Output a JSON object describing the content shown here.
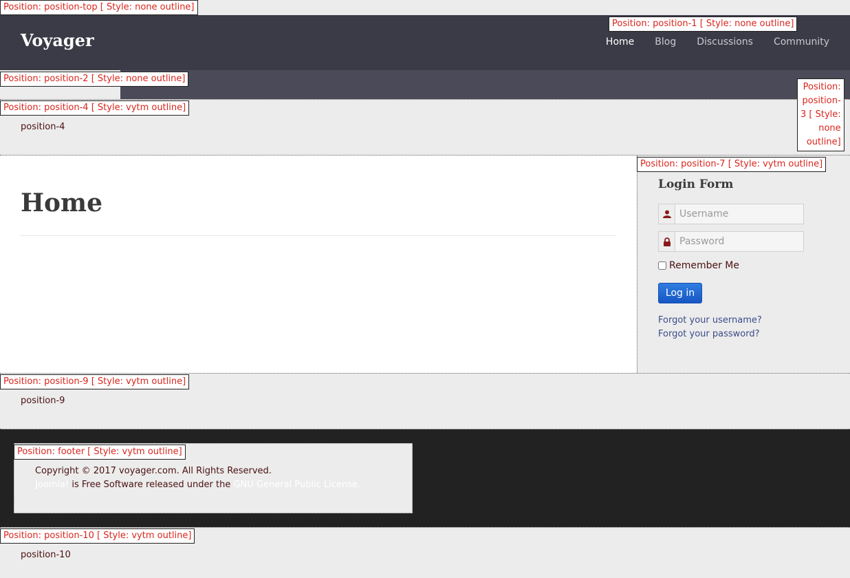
{
  "labels": {
    "position_top": "Position: position-top [ Style: none outline]",
    "position_1": "Position: position-1 [ Style: none outline]",
    "position_2": "Position: position-2 [ Style: none outline]",
    "position_3": [
      "Position:",
      "position-",
      "3 [ Style:",
      "none",
      "outline]"
    ],
    "position_4": "Position: position-4 [ Style: vytm outline]",
    "position_7": "Position: position-7 [ Style: vytm outline]",
    "position_9": "Position: position-9 [ Style: vytm outline]",
    "footer": "Position: footer [ Style: vytm outline]",
    "position_10": "Position: position-10 [ Style: vytm outline]"
  },
  "header": {
    "logo": "Voyager",
    "nav": [
      {
        "label": "Home",
        "active": true
      },
      {
        "label": "Blog",
        "active": false
      },
      {
        "label": "Discussions",
        "active": false
      },
      {
        "label": "Community",
        "active": false
      }
    ]
  },
  "position_texts": {
    "pos4": "position-4",
    "pos9": "position-9",
    "pos10": "position-10"
  },
  "main": {
    "title": "Home"
  },
  "login": {
    "title": "Login Form",
    "username_placeholder": "Username",
    "password_placeholder": "Password",
    "remember_label": "Remember Me",
    "button_label": "Log in",
    "forgot_username": "Forgot your username?",
    "forgot_password": "Forgot your password?"
  },
  "footer": {
    "copyright": "Copyright © 2017 voyager.com. All Rights Reserved.",
    "joomla": "Joomla!",
    "license_middle": " is Free Software released under the ",
    "gpl": "GNU General Public License."
  },
  "colors": {
    "header_bg": "#3b3b47",
    "label_text": "#d9251c",
    "button": "#1656c4",
    "footer_bg": "#222222"
  }
}
